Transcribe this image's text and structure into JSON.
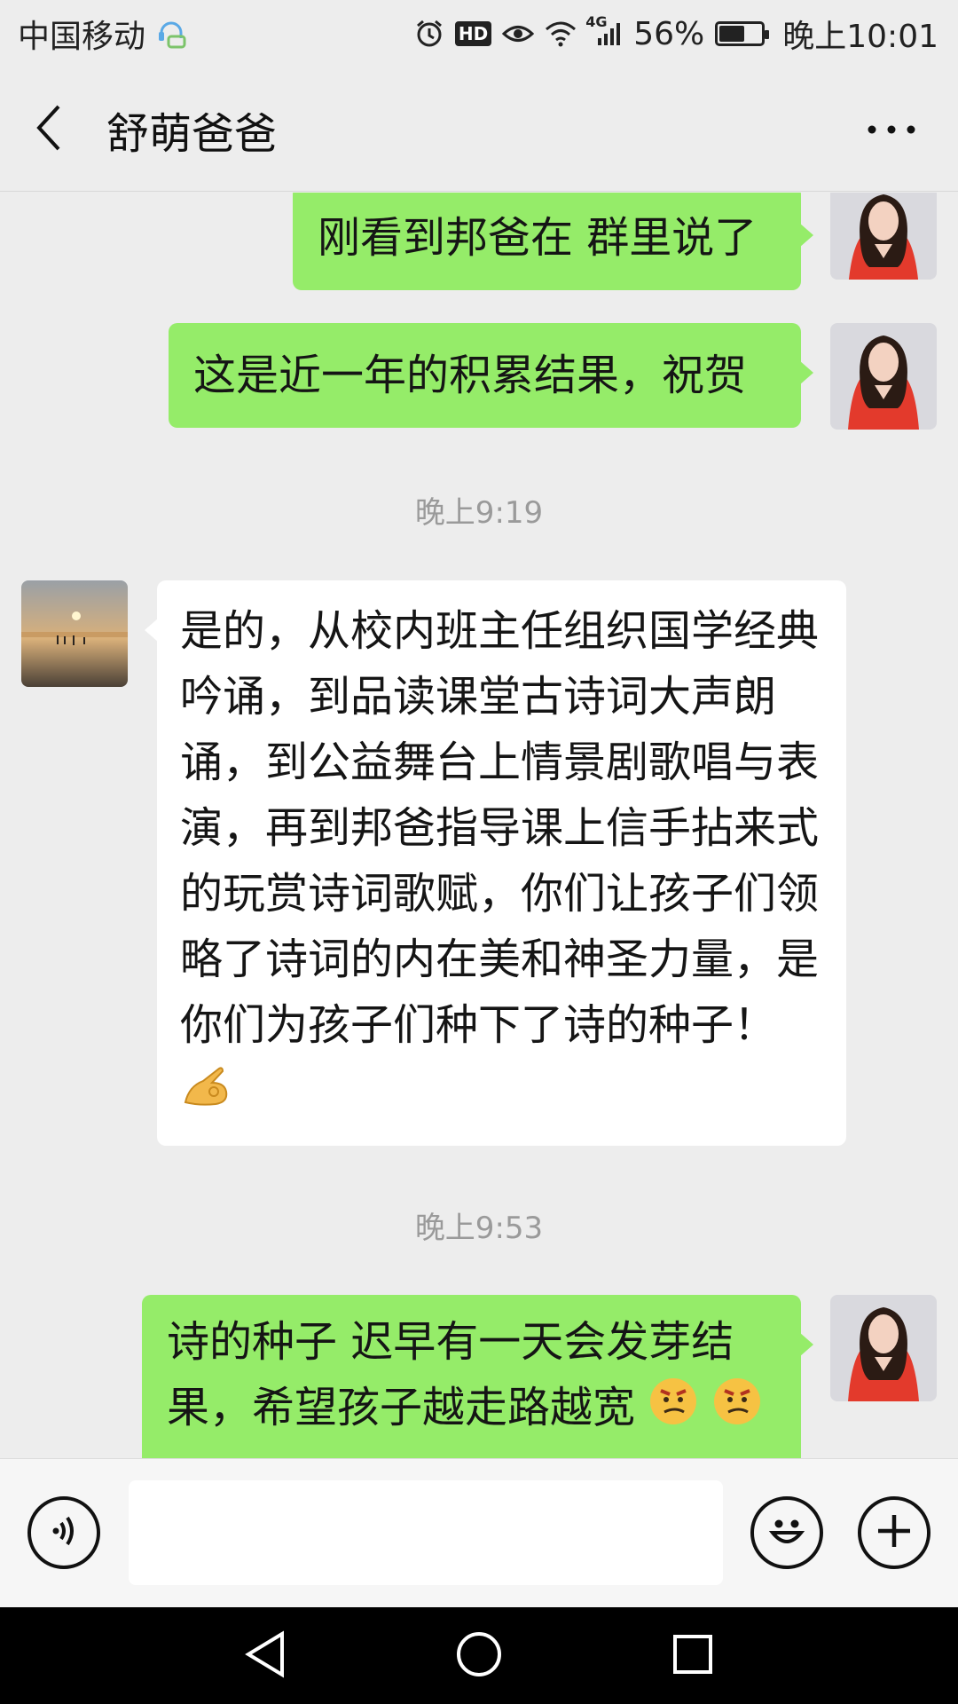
{
  "status_bar": {
    "carrier": "中国移动",
    "network": "4G",
    "battery_percent": "56%",
    "time": "晚上10:01",
    "hd_label": "HD",
    "icons": [
      "assistant-icon",
      "alarm-icon",
      "hd-icon",
      "eye-icon",
      "wifi-icon",
      "signal-icon",
      "battery-icon"
    ]
  },
  "header": {
    "title": "舒萌爸爸",
    "back_icon": "chevron-left-icon",
    "more_icon": "more-dots-icon"
  },
  "messages": [
    {
      "sender": "me",
      "text": "刚看到邦爸在 群里说了"
    },
    {
      "sender": "me",
      "text": "这是近一年的积累结果，祝贺"
    },
    {
      "type": "timestamp",
      "text": "晚上9:19"
    },
    {
      "sender": "them",
      "text": "是的，从校内班主任组织国学经典吟诵，到品读课堂古诗词大声朗诵，到公益舞台上情景剧歌唱与表演，再到邦爸指导课上信手拈来式的玩赏诗词歌赋，你们让孩子们领略了诗词的内在美和神圣力量，是你们为孩子们种下了诗的种子！",
      "emoji": "ok-hand-emoji"
    },
    {
      "type": "timestamp",
      "text": "晚上9:53"
    },
    {
      "sender": "me",
      "text_line1": "诗的种子  迟早有一天会发芽结",
      "text_line2": "果，希望孩子越走路越宽",
      "emoji": "smirk-face-emoji"
    }
  ],
  "input_bar": {
    "voice_icon": "voice-icon",
    "emoji_icon": "smiley-icon",
    "plus_icon": "plus-icon",
    "input_value": ""
  },
  "nav_bar": {
    "icons": [
      "nav-back-icon",
      "nav-home-icon",
      "nav-recent-icon"
    ]
  },
  "colors": {
    "my_bubble": "#95ec69",
    "their_bubble": "#ffffff",
    "background": "#ededed"
  }
}
